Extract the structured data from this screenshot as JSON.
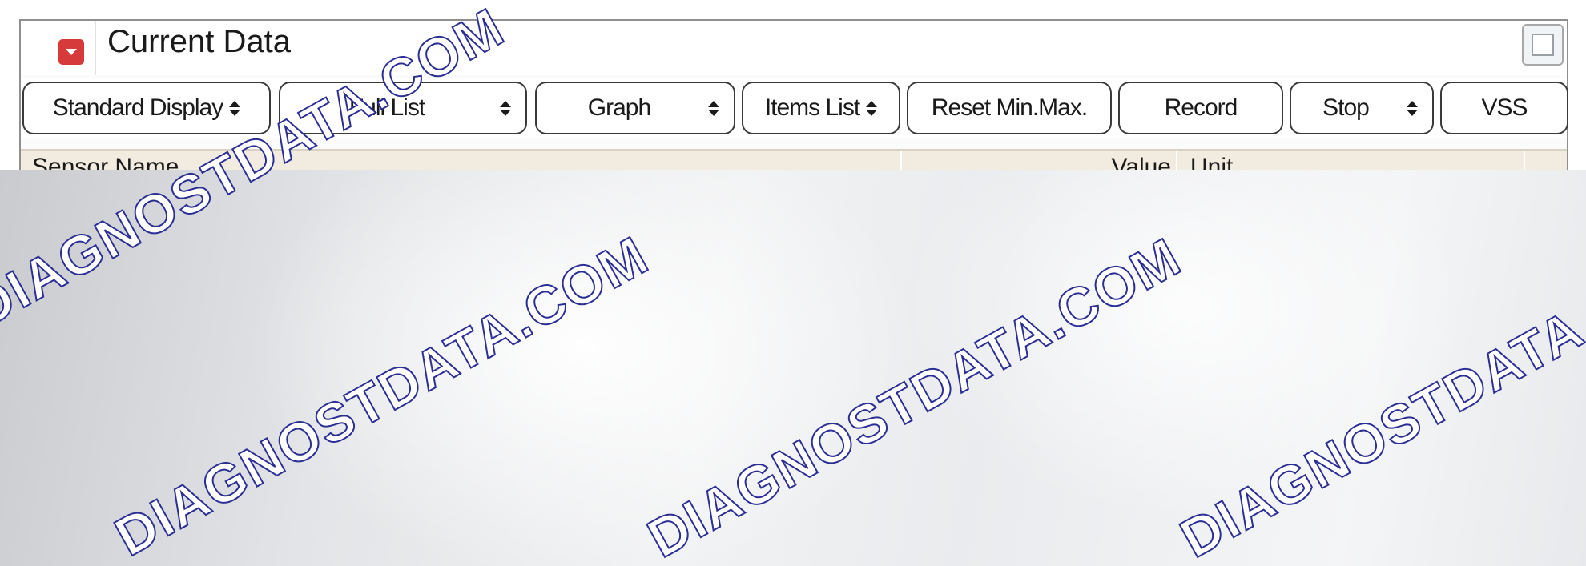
{
  "window": {
    "title": "Current Data"
  },
  "toolbar": {
    "buttons": [
      {
        "label": "Standard Display",
        "dropdown": true
      },
      {
        "label": "Full List",
        "dropdown": true
      },
      {
        "label": "Graph",
        "dropdown": true
      },
      {
        "label": "Items List",
        "dropdown": true
      },
      {
        "label": "Reset Min.Max.",
        "dropdown": false
      },
      {
        "label": "Record",
        "dropdown": false
      },
      {
        "label": "Stop",
        "dropdown": true
      },
      {
        "label": "VSS",
        "dropdown": false
      }
    ]
  },
  "table": {
    "columns": [
      "Sensor Name",
      "Value",
      "Unit"
    ]
  },
  "watermark": {
    "text": "DIAGNOSTDATA.COM",
    "color": "#2b2f95"
  },
  "colors": {
    "title_icon": "#d63a3a",
    "header_bg": "#f1ecdf"
  },
  "icons": {
    "title": "collapse-icon",
    "window": "window-icon"
  }
}
